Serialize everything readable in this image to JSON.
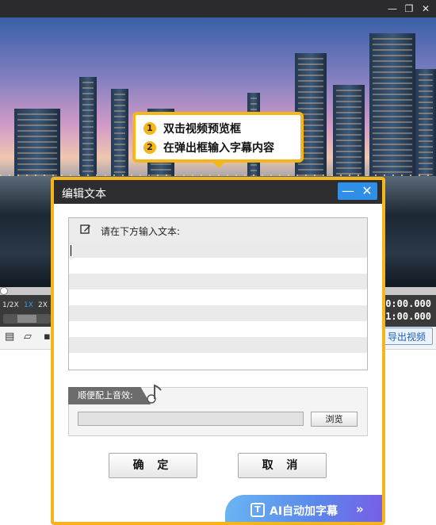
{
  "window": {
    "buttons": {
      "restore": "❐",
      "close": "✕"
    }
  },
  "tip": {
    "steps": [
      {
        "num": "1",
        "text": "双击视频预览框"
      },
      {
        "num": "2",
        "text": "在弹出框输入字幕内容"
      }
    ],
    "accent": "#f4b619"
  },
  "player": {
    "speeds": [
      "1/2X",
      "1X",
      "2X"
    ],
    "active_speed": "1X",
    "time_current": "0:00.000",
    "time_total": "1:00.000",
    "export_label": "导出视频"
  },
  "dialog": {
    "title": "编辑文本",
    "minimize": "—",
    "close": "✕",
    "editor_label": "请在下方输入文本:",
    "editor_value": "",
    "sound_label": "顺便配上音效:",
    "sound_value": "",
    "browse_label": "浏览",
    "ok_label": "确 定",
    "cancel_label": "取 消",
    "ai_label": "AI自动加字幕",
    "ai_chevron": "»"
  },
  "icons": [
    "edit-icon",
    "music-note-icon",
    "ai-subtitle-icon",
    "minimize-icon",
    "close-icon"
  ]
}
